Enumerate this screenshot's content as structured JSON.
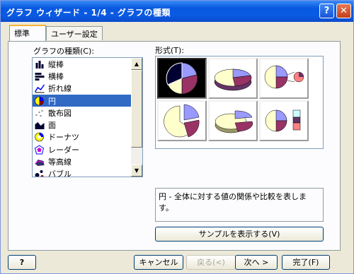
{
  "window": {
    "title": "グラフ ウィザード - 1/4 - グラフの種類"
  },
  "titlebar": {
    "help_glyph": "?",
    "close_glyph": "✕"
  },
  "tabs": [
    {
      "label": "標準"
    },
    {
      "label": "ユーザー設定"
    }
  ],
  "chart_type_label": "グラフの種類(C):",
  "chart_types": [
    {
      "label": "縦棒",
      "icon": "column-chart-icon"
    },
    {
      "label": "横棒",
      "icon": "bar-chart-icon"
    },
    {
      "label": "折れ線",
      "icon": "line-chart-icon"
    },
    {
      "label": "円",
      "icon": "pie-chart-icon",
      "selected": true
    },
    {
      "label": "散布図",
      "icon": "scatter-chart-icon"
    },
    {
      "label": "面",
      "icon": "area-chart-icon"
    },
    {
      "label": "ドーナツ",
      "icon": "doughnut-chart-icon"
    },
    {
      "label": "レーダー",
      "icon": "radar-chart-icon"
    },
    {
      "label": "等高線",
      "icon": "surface-chart-icon"
    },
    {
      "label": "バブル",
      "icon": "bubble-chart-icon"
    }
  ],
  "subtype_label": "形式(T):",
  "description": "円 - 全体に対する値の関係や比較を表します。",
  "buttons": {
    "sample": "サンプルを表示する(V)",
    "help": "?",
    "cancel": "キャンセル",
    "back": "戻る(<)",
    "next": "次へ >",
    "finish": "完了(F)"
  },
  "colors": {
    "pie_a": "#9999ff",
    "pie_b": "#993366",
    "pie_c": "#ffffcc",
    "pie_d": "#ccffff",
    "accent": "#316ac5"
  }
}
